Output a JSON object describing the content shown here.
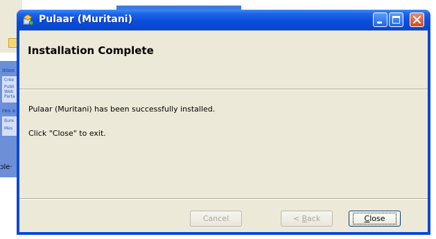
{
  "background": {
    "sidebar_heading_1": "ition",
    "sidebar_items_1": [
      "Crée",
      "Publi",
      "Web",
      "Parta"
    ],
    "sidebar_heading_2": "res e",
    "sidebar_items_2": [
      "Bure",
      "Mes"
    ],
    "fragment_text": "ɔle·"
  },
  "dialog": {
    "title": "Pulaar (Muritani)",
    "icon": "installer-icon",
    "heading": "Installation Complete",
    "message_line1": "Pulaar (Muritani) has been successfully installed.",
    "message_line2": "Click \"Close\" to exit.",
    "buttons": {
      "cancel": "Cancel",
      "back_mnemonic": "B",
      "back_rest": "ack",
      "back_prefix": "< ",
      "close_mnemonic": "C",
      "close_rest": "lose"
    },
    "colors": {
      "titlebar": "#0a4fe0",
      "client_bg": "#ece9d8",
      "close_button": "#d24b22"
    }
  }
}
